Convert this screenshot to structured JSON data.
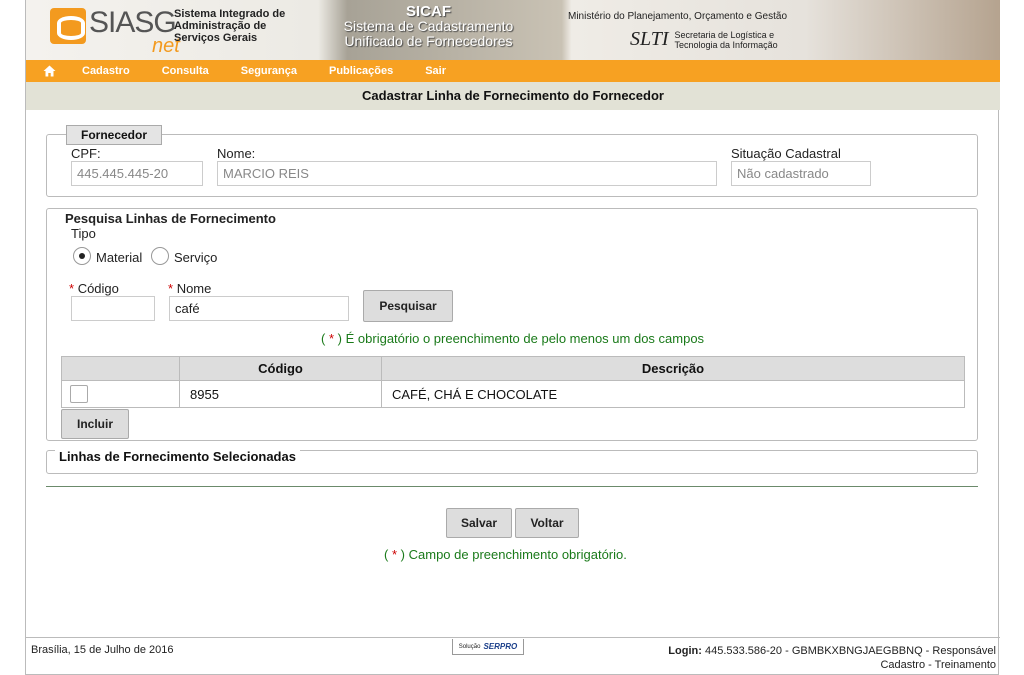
{
  "header": {
    "logo_text": "SIASG",
    "logo_net": "net",
    "siasg_title_1": "Sistema Integrado de",
    "siasg_title_2": "Administração de",
    "siasg_title_3": "Serviços Gerais",
    "sicaf_title": "SICAF",
    "sicaf_sub_1": "Sistema de Cadastramento",
    "sicaf_sub_2": "Unificado de Fornecedores",
    "ministerio": "Ministério do Planejamento, Orçamento e Gestão",
    "slti_mark": "SLTI",
    "slti_text_1": "Secretaria de Logística e",
    "slti_text_2": "Tecnologia da Informação"
  },
  "menu": {
    "home_icon": "home-icon",
    "items": [
      "Cadastro",
      "Consulta",
      "Segurança",
      "Publicações",
      "Sair"
    ]
  },
  "page_title": "Cadastrar Linha de Fornecimento do Fornecedor",
  "fornecedor": {
    "legend": "Fornecedor",
    "cpf_label": "CPF:",
    "cpf_value": "445.445.445-20",
    "nome_label": "Nome:",
    "nome_value": "MARCIO REIS",
    "situacao_label": "Situação Cadastral",
    "situacao_value": "Não cadastrado"
  },
  "pesquisa": {
    "legend": "Pesquisa Linhas de Fornecimento",
    "tipo_label": "Tipo",
    "radio_material": "Material",
    "radio_servico": "Serviço",
    "selected_tipo": "Material",
    "required_mark": "*",
    "codigo_label": "Código",
    "codigo_value": "",
    "nome_label": "Nome",
    "nome_value": "café",
    "search_button": "Pesquisar",
    "note_open": "(",
    "note_close": ")",
    "note_text": "É obrigatório o preenchimento de pelo menos um dos campos"
  },
  "results": {
    "columns": [
      "",
      "Código",
      "Descrição"
    ],
    "rows": [
      {
        "codigo": "8955",
        "descricao": "CAFÉ, CHÁ E CHOCOLATE",
        "checked": false
      }
    ],
    "include_button": "Incluir"
  },
  "selecionadas": {
    "legend": "Linhas de Fornecimento Selecionadas"
  },
  "actions": {
    "save_button": "Salvar",
    "back_button": "Voltar",
    "required_note": "Campo de preenchimento obrigatório."
  },
  "footer": {
    "date": "Brasília, 15 de Julho de 2016",
    "serpro_prefix": "Solução",
    "serpro_name": "SERPRO",
    "login_label": "Login:",
    "login_value": "445.533.586-20 - GBMBKXBNGJAEGBBNQ - Responsável",
    "login_line2": "Cadastro - Treinamento"
  },
  "colors": {
    "menu_bar": "#f7a122",
    "title_bar": "#e2e2d6",
    "note_green": "#1a7a1a",
    "required_red": "#cc0000"
  }
}
